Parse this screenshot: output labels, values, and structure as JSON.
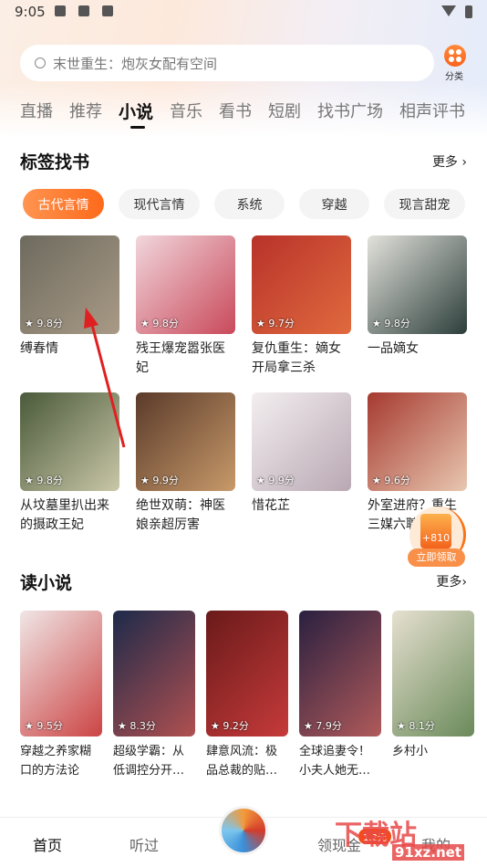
{
  "status": {
    "time": "9:05"
  },
  "search": {
    "placeholder": "末世重生：炮灰女配有空间"
  },
  "category": {
    "label": "分类"
  },
  "tabs": [
    "直播",
    "推荐",
    "小说",
    "音乐",
    "看书",
    "短剧",
    "找书广场",
    "相声评书"
  ],
  "active_tab": "小说",
  "tag_section": {
    "title": "标签找书",
    "more": "更多 ›",
    "chips": [
      "古代言情",
      "现代言情",
      "系统",
      "穿越",
      "现言甜宠"
    ],
    "books": [
      {
        "title": "缚春情",
        "rating": "9.8分"
      },
      {
        "title": "残王爆宠嚣张医妃",
        "rating": "9.8分"
      },
      {
        "title": "复仇重生：嫡女开局拿三杀",
        "rating": "9.7分"
      },
      {
        "title": "一品嫡女",
        "rating": "9.8分"
      },
      {
        "title": "从坟墓里扒出来的摄政王妃",
        "rating": "9.8分"
      },
      {
        "title": "绝世双萌：神医娘亲超厉害",
        "rating": "9.9分"
      },
      {
        "title": "惜花芷",
        "rating": "9.9分"
      },
      {
        "title": "外室进府？重生三媒六聘",
        "rating": "9.6分"
      }
    ]
  },
  "read_section": {
    "title": "读小说",
    "more": "更多›",
    "books": [
      {
        "title": "穿越之养家糊口的方法论",
        "rating": "9.5分"
      },
      {
        "title": "超级学霸：从低调控分开…",
        "rating": "8.3分"
      },
      {
        "title": "肆意风流：极品总裁的贴…",
        "rating": "9.2分"
      },
      {
        "title": "全球追妻令！小夫人她无…",
        "rating": "7.9分"
      },
      {
        "title": "乡村小",
        "rating": "8.1分"
      }
    ]
  },
  "reward": {
    "amount": "+810",
    "button": "立即领取"
  },
  "nav": {
    "home": "首页",
    "history": "听过",
    "cash": "领现金",
    "cash_badge": "1.2元",
    "mine": "我的"
  },
  "watermark": {
    "text": "下载站",
    "url": "91xz.net"
  },
  "colors": {
    "accent": "#fd6a1b",
    "annotation_arrow": "#e02020"
  }
}
